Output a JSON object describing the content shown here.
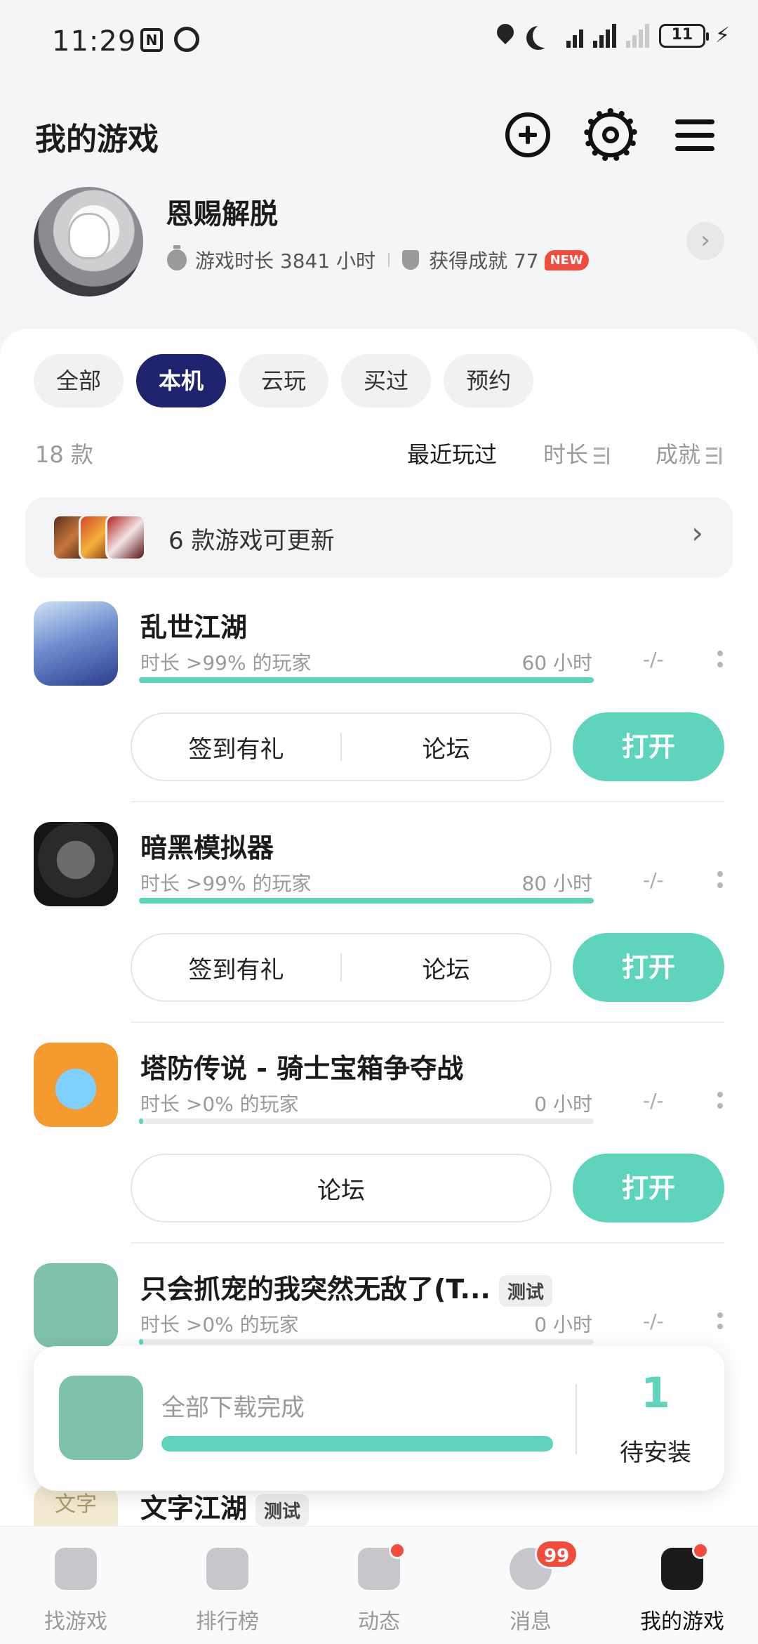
{
  "status_bar": {
    "time": "11:29",
    "battery": "11"
  },
  "header": {
    "title": "我的游戏"
  },
  "profile": {
    "name": "恩赐解脱",
    "playtime_label": "游戏时长 3841 小时",
    "achievements_label": "获得成就 77",
    "new_badge": "NEW"
  },
  "tabs": [
    {
      "label": "全部",
      "active": false
    },
    {
      "label": "本机",
      "active": true
    },
    {
      "label": "云玩",
      "active": false
    },
    {
      "label": "买过",
      "active": false
    },
    {
      "label": "预约",
      "active": false
    }
  ],
  "list_meta": {
    "count": "18 款",
    "sort_recent": "最近玩过",
    "sort_duration": "时长",
    "sort_achievement": "成就"
  },
  "update_banner": {
    "text": "6 款游戏可更新"
  },
  "games": [
    {
      "name": "乱世江湖",
      "rank": "时长 >99% 的玩家",
      "hours": "60 小时",
      "achievement": "-/-",
      "progress": 1.0,
      "actions": [
        "签到有礼",
        "论坛"
      ],
      "open": "打开"
    },
    {
      "name": "暗黑模拟器",
      "rank": "时长 >99% 的玩家",
      "hours": "80 小时",
      "achievement": "-/-",
      "progress": 1.0,
      "actions": [
        "签到有礼",
        "论坛"
      ],
      "open": "打开"
    },
    {
      "name": "塔防传说 - 骑士宝箱争夺战",
      "rank": "时长 >0% 的玩家",
      "hours": "0 小时",
      "achievement": "-/-",
      "progress": 0.01,
      "actions": [
        "论坛"
      ],
      "open": "打开"
    },
    {
      "name": "只会抓宠的我突然无敌了(T...",
      "tag": "测试",
      "rank": "时长 >0% 的玩家",
      "hours": "0 小时",
      "achievement": "-/-",
      "progress": 0.01
    },
    {
      "name": "文字江湖",
      "tag": "测试",
      "icon_text": "文字"
    }
  ],
  "download_popup": {
    "status": "全部下载完成",
    "progress": 1.0,
    "pending_count": "1",
    "pending_label": "待安装"
  },
  "bottom_nav": [
    {
      "label": "找游戏"
    },
    {
      "label": "排行榜"
    },
    {
      "label": "动态"
    },
    {
      "label": "消息",
      "badge": "99"
    },
    {
      "label": "我的游戏",
      "active": true
    }
  ],
  "colors": {
    "accent": "#5fd4bd",
    "tab_active": "#1f226e",
    "badge_red": "#f24c3d"
  }
}
